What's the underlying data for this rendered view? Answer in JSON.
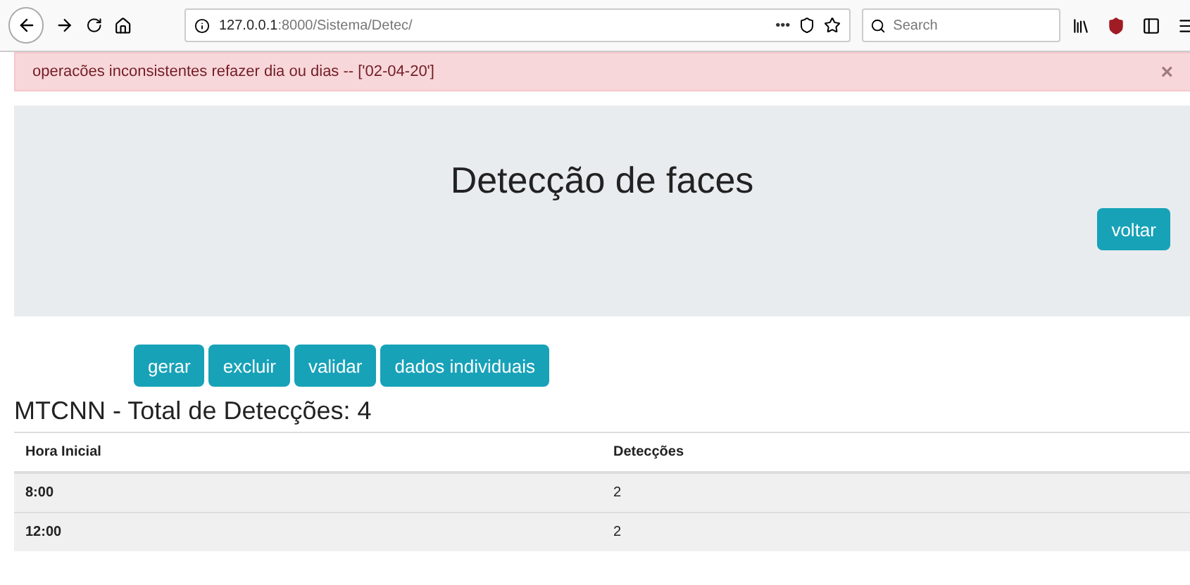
{
  "browser": {
    "url_host": "127.0.0.1",
    "url_path": ":8000/Sistema/Detec/",
    "page_actions": "•••",
    "search": {
      "placeholder": "Search"
    }
  },
  "alert": {
    "message": "operacões inconsistentes refazer dia ou dias -- ['02-04-20']",
    "close": "×"
  },
  "header": {
    "title": "Detecção de faces",
    "back_button": "voltar"
  },
  "actions": [
    "gerar",
    "excluir",
    "validar",
    "dados individuais"
  ],
  "heading": "MTCNN - Total de Detecções: 4",
  "table": {
    "columns": [
      "Hora Inicial",
      "Detecções"
    ],
    "rows": [
      [
        "8:00",
        "2"
      ],
      [
        "12:00",
        "2"
      ]
    ]
  }
}
